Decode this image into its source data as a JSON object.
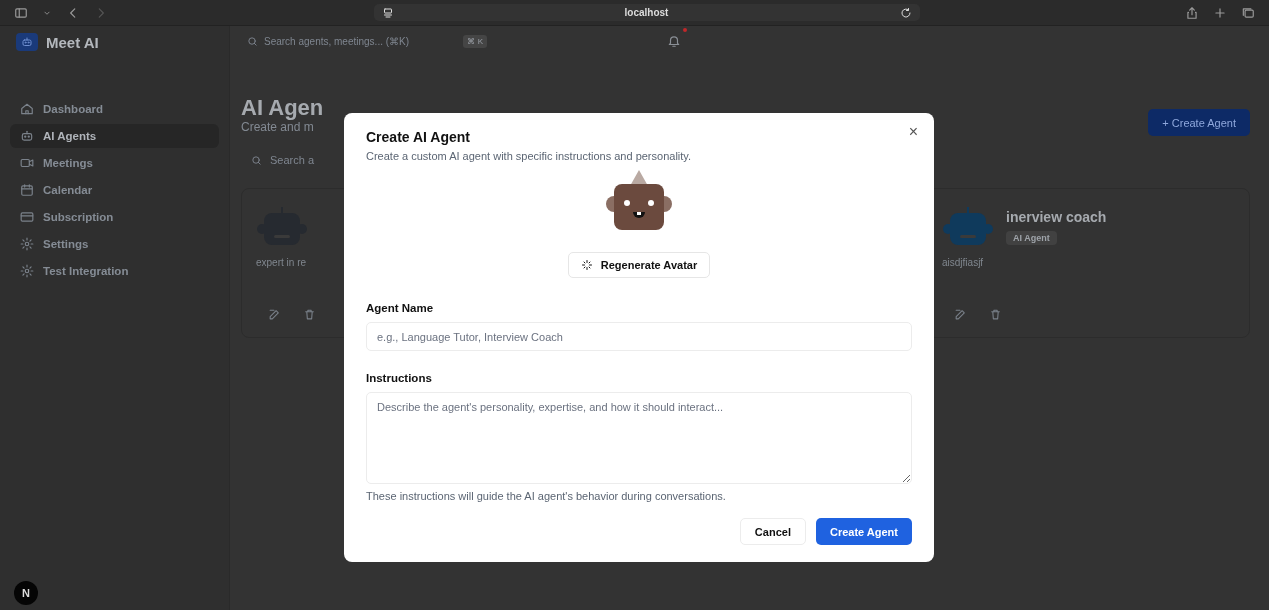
{
  "browser": {
    "url": "localhost"
  },
  "sidebar": {
    "app_name": "Meet AI",
    "items": [
      {
        "label": "Dashboard",
        "selected": false
      },
      {
        "label": "AI Agents",
        "selected": true
      },
      {
        "label": "Meetings",
        "selected": false
      },
      {
        "label": "Calendar",
        "selected": false
      },
      {
        "label": "Subscription",
        "selected": false
      },
      {
        "label": "Settings",
        "selected": false
      },
      {
        "label": "Test Integration",
        "selected": false
      }
    ],
    "badge": "N"
  },
  "header": {
    "search_placeholder": "Search agents, meetings... (⌘K)",
    "shortcut": "⌘ K",
    "notification_dot": true
  },
  "page": {
    "title": "AI Agen",
    "subtitle": "Create and m",
    "create_button": "+ Create Agent",
    "search_placeholder": "Search a"
  },
  "agents": [
    {
      "description": "expert in re",
      "color": "#262a30"
    },
    {
      "name": "inerview coach",
      "tag": "AI Agent",
      "description": "aisdjfiasjf",
      "color": "#0f3a5c"
    }
  ],
  "dialog": {
    "title": "Create AI Agent",
    "description": "Create a custom AI agent with specific instructions and personality.",
    "close": "×",
    "regenerate_button": "Regenerate Avatar",
    "fields": [
      {
        "label": "Agent Name",
        "kind": "input",
        "placeholder": "e.g., Language Tutor, Interview Coach"
      },
      {
        "label": "Instructions",
        "kind": "textarea",
        "placeholder": "Describe the agent's personality, expertise, and how it should interact...",
        "hint": "These instructions will guide the AI agent's behavior during conversations."
      }
    ],
    "buttons": [
      {
        "label": "Cancel",
        "kind": "secondary"
      },
      {
        "label": "Create Agent",
        "kind": "primary"
      }
    ]
  }
}
